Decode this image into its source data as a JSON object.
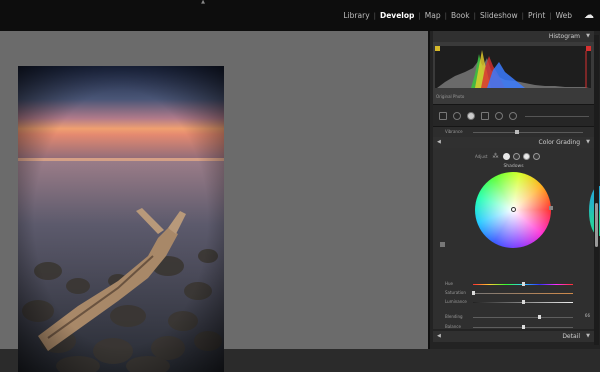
{
  "modules": {
    "items": [
      "Library",
      "Develop",
      "Map",
      "Book",
      "Slideshow",
      "Print",
      "Web"
    ],
    "active": "Develop"
  },
  "histogram": {
    "title": "Histogram",
    "info": "Original Photo",
    "colors": {
      "red": "#d83030",
      "green": "#3fbf3f",
      "blue": "#3b7bff",
      "yellow": "#e6d02a"
    }
  },
  "basic_row": {
    "label": "Vibrance"
  },
  "color_grading": {
    "title": "Color Grading",
    "adjust_label": "Adjust",
    "mode_label": "Shadows",
    "sliders": [
      {
        "label": "Hue",
        "value": "",
        "fraction": 0.5,
        "track": "hue"
      },
      {
        "label": "Saturation",
        "value": "",
        "fraction": 0.0,
        "track": "sat"
      },
      {
        "label": "Luminance",
        "value": "",
        "fraction": 0.5,
        "track": "lum"
      },
      {
        "label": "Blending",
        "value": "66",
        "fraction": 0.66,
        "track": "gray"
      },
      {
        "label": "Balance",
        "value": "",
        "fraction": 0.5,
        "track": "gray"
      }
    ]
  },
  "detail": {
    "title": "Detail"
  },
  "accent": {
    "active_text": "#ffffff",
    "panel_bg": "#232323",
    "canvas_bg": "#6b6b6b"
  }
}
